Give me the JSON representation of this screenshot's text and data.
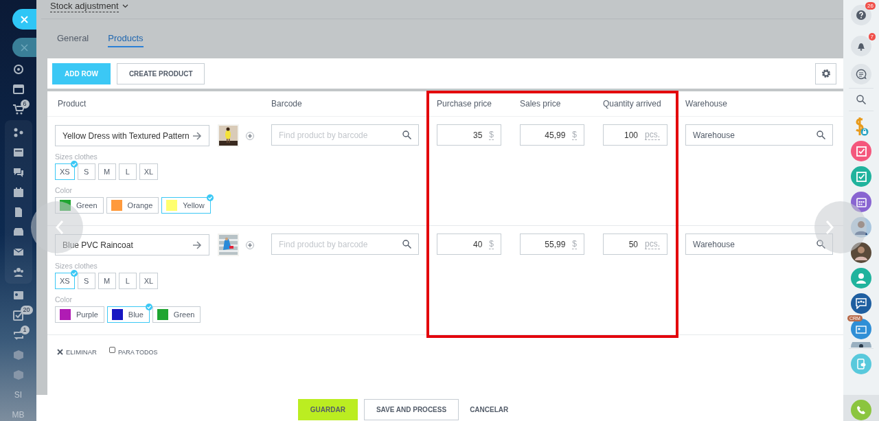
{
  "header": {
    "title": "Stock adjustment"
  },
  "tabs": [
    {
      "label": "General",
      "selected": false
    },
    {
      "label": "Products",
      "selected": true
    }
  ],
  "toolbar": {
    "buttons": [
      {
        "label": "ADD ROW",
        "kind": "primary"
      },
      {
        "label": "CREATE PRODUCT",
        "kind": "secondary"
      }
    ]
  },
  "table": {
    "columns": [
      "Product",
      "Barcode",
      "Purchase price",
      "Sales price",
      "Quantity arrived",
      "Warehouse"
    ],
    "rows": [
      {
        "product": "Yellow Dress with Textured Pattern",
        "barcode_placeholder": "Find product by barcode",
        "sizes_label": "Sizes clothes",
        "sizes": [
          {
            "label": "XS",
            "selected": true
          },
          {
            "label": "S",
            "selected": false
          },
          {
            "label": "M",
            "selected": false
          },
          {
            "label": "L",
            "selected": false
          },
          {
            "label": "XL",
            "selected": false
          }
        ],
        "color_label": "Color",
        "colors": [
          {
            "label": "Green",
            "color": "#1fa531",
            "selected": false
          },
          {
            "label": "Orange",
            "color": "#ff9a3c",
            "selected": false
          },
          {
            "label": "Yellow",
            "color": "#ffff6e",
            "selected": true
          }
        ],
        "purchase_price": "35",
        "purchase_unit": "$",
        "sales_price": "45,99",
        "sales_unit": "$",
        "quantity": "100",
        "quantity_unit": "pcs.",
        "warehouse": "Warehouse"
      },
      {
        "product": "Blue PVC Raincoat",
        "barcode_placeholder": "Find product by barcode",
        "sizes_label": "Sizes clothes",
        "sizes": [
          {
            "label": "XS",
            "selected": true
          },
          {
            "label": "S",
            "selected": false
          },
          {
            "label": "M",
            "selected": false
          },
          {
            "label": "L",
            "selected": false
          },
          {
            "label": "XL",
            "selected": false
          }
        ],
        "color_label": "Color",
        "colors": [
          {
            "label": "Purple",
            "color": "#b01cb4",
            "selected": false
          },
          {
            "label": "Blue",
            "color": "#1616c2",
            "selected": true
          },
          {
            "label": "Green",
            "color": "#1fa531",
            "selected": false
          }
        ],
        "purchase_price": "40",
        "purchase_unit": "$",
        "sales_price": "55,99",
        "sales_unit": "$",
        "quantity": "50",
        "quantity_unit": "pcs.",
        "warehouse": "Warehouse"
      }
    ]
  },
  "row_actions": {
    "delete": "ELIMINAR",
    "for_all": {
      "label": "PARA TODOS",
      "checked": false
    }
  },
  "bottom_buttons": [
    {
      "label": "GUARDAR",
      "kind": "success"
    },
    {
      "label": "SAVE AND PROCESS",
      "kind": "secondary"
    },
    {
      "label": "CANCELAR",
      "kind": "link"
    }
  ],
  "left_nav": {
    "cart_badge": "6",
    "tasks_badge": "20",
    "sync_badge": "1",
    "initials": [
      "SI",
      "MB"
    ]
  },
  "right_nav": {
    "help_badge": "26",
    "notifications_badge": "7",
    "crm_label": "CRM"
  }
}
